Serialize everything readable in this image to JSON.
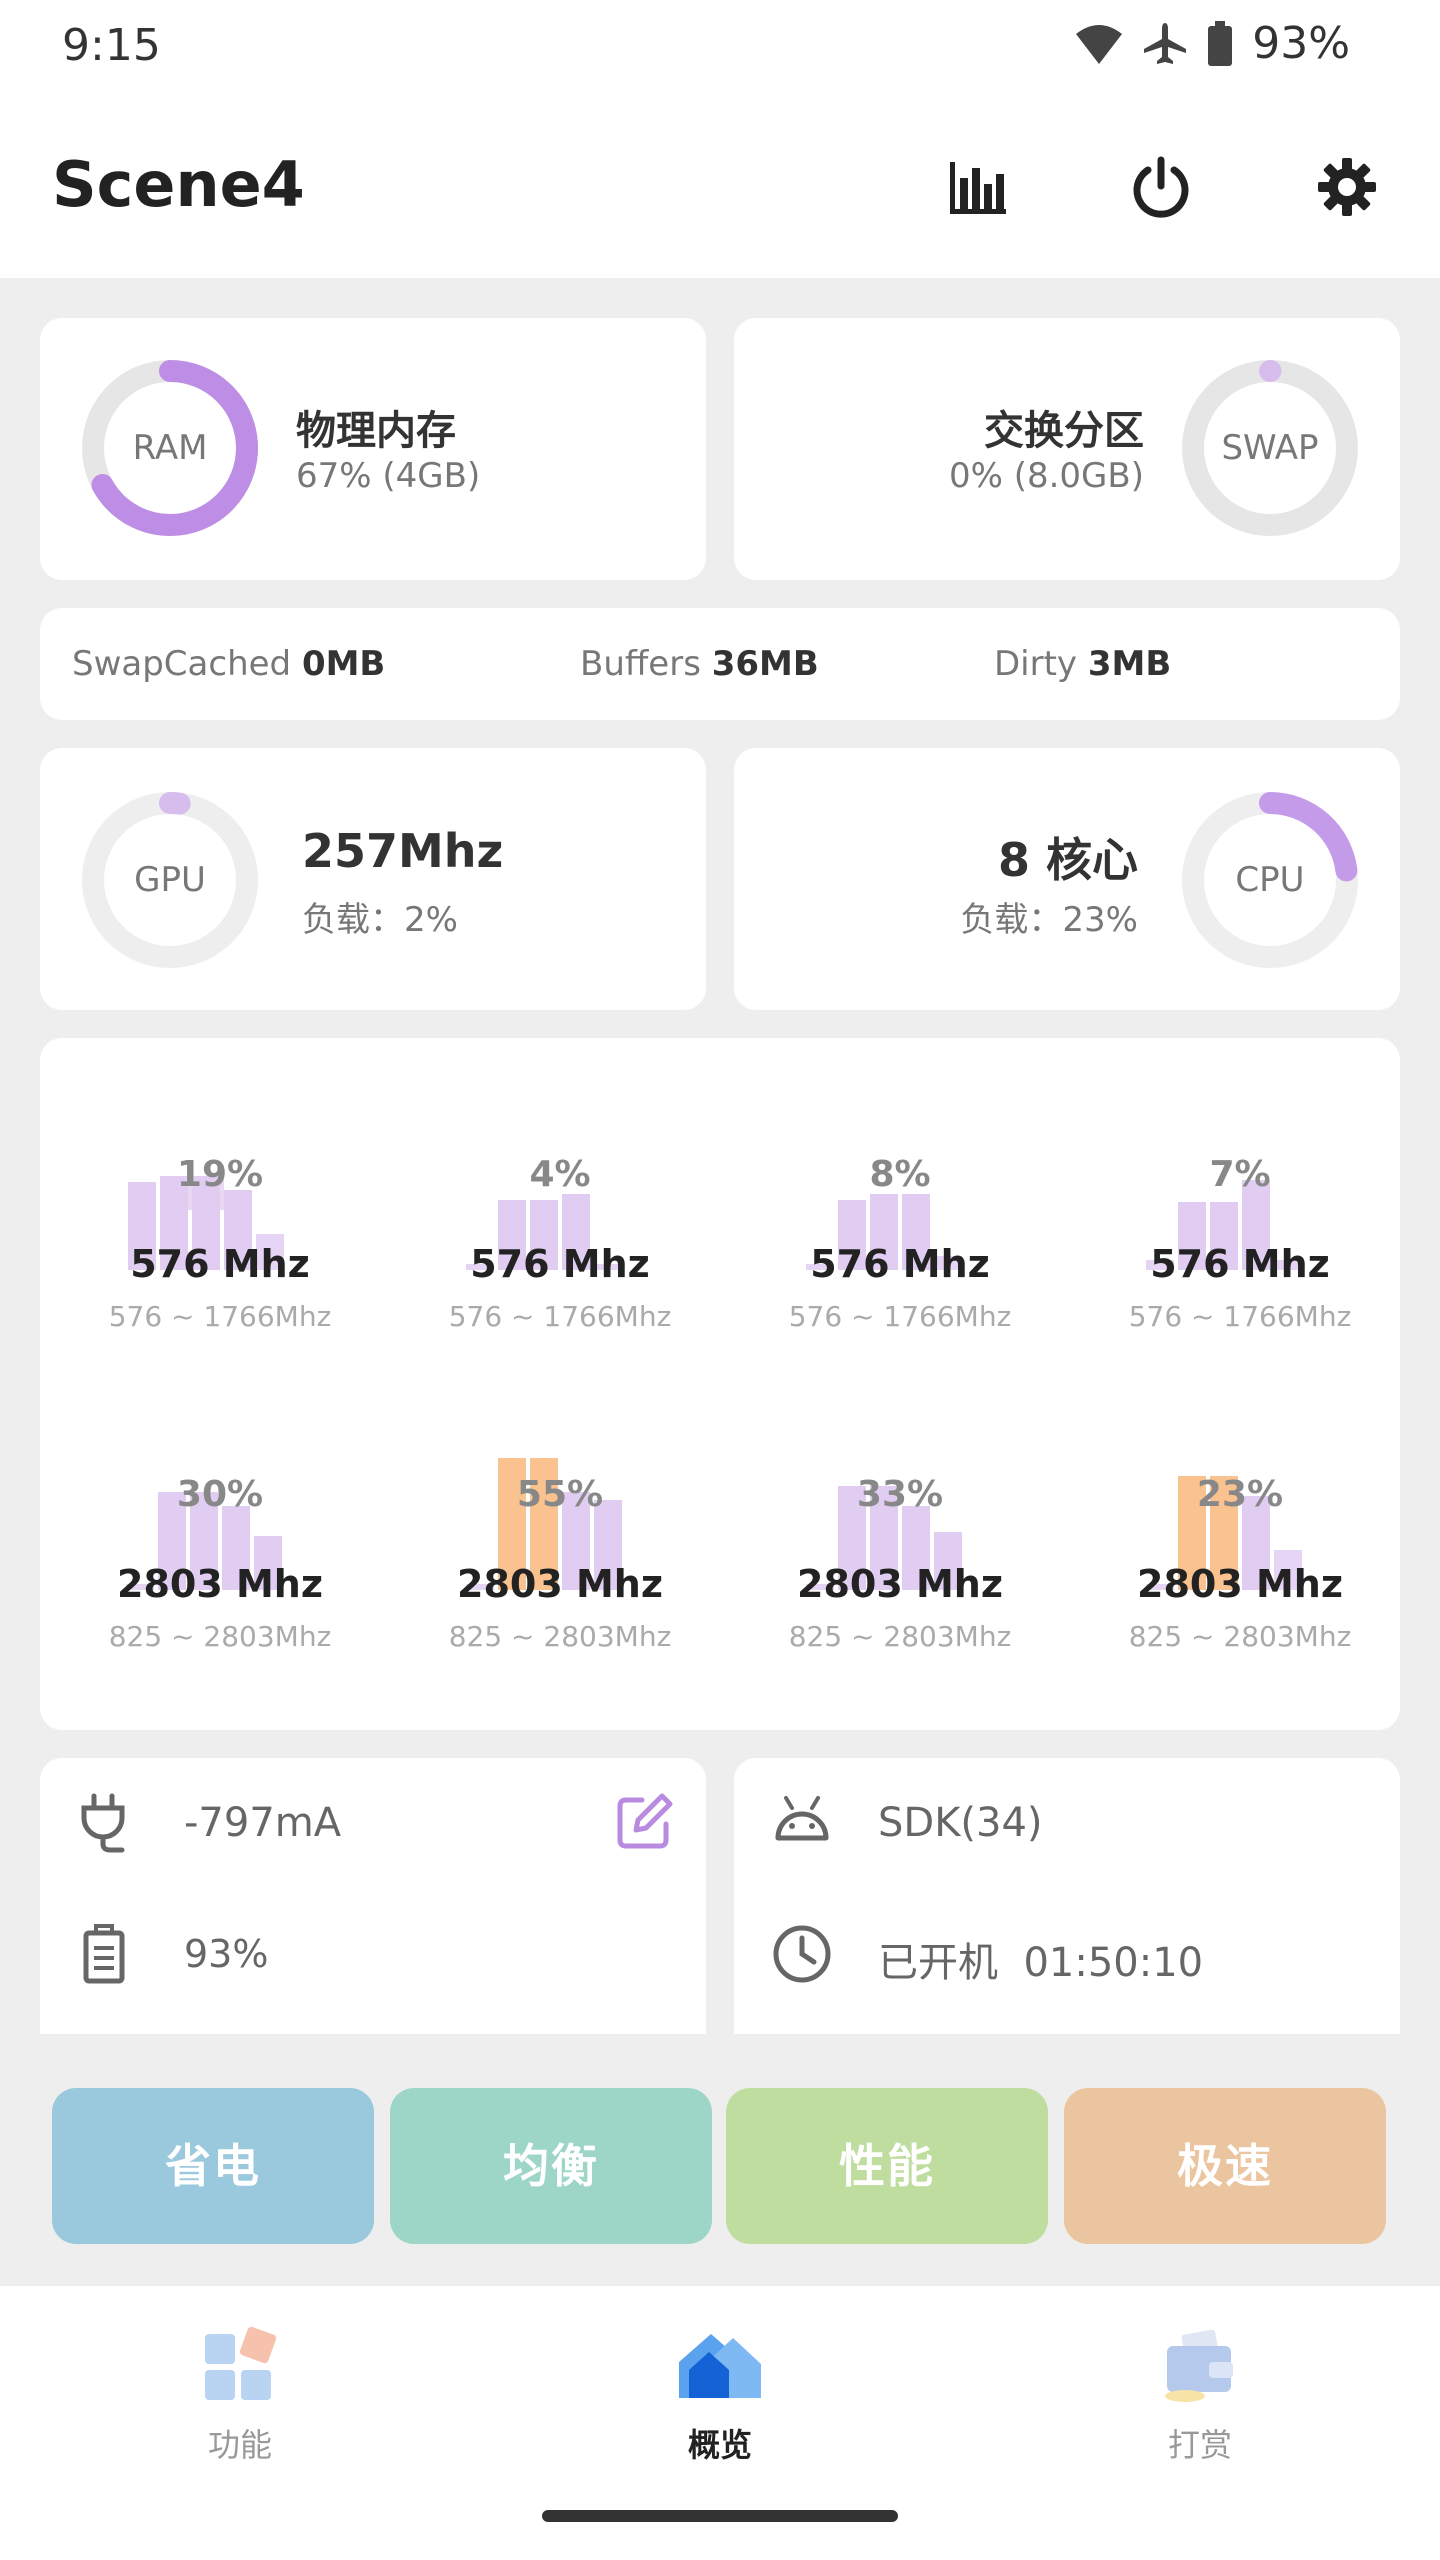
{
  "status_bar": {
    "time": "9:15",
    "battery_pct": "93%"
  },
  "app_bar": {
    "title": "Scene4"
  },
  "ram": {
    "ring_label": "RAM",
    "title": "物理内存",
    "detail": "67% (4GB)",
    "used_fraction": 0.67,
    "color": "#be8ee6"
  },
  "swap": {
    "ring_label": "SWAP",
    "title": "交换分区",
    "detail": "0% (8.0GB)",
    "used_fraction": 0.0,
    "color": "#d7bdee"
  },
  "mem_stats": [
    {
      "label": "SwapCached ",
      "value": "0MB"
    },
    {
      "label": "Buffers ",
      "value": "36MB"
    },
    {
      "label": "Dirty ",
      "value": "3MB"
    }
  ],
  "gpu": {
    "ring_label": "GPU",
    "freq": "257Mhz",
    "load": "负载：2%",
    "load_fraction": 0.02
  },
  "cpu": {
    "ring_label": "CPU",
    "cores": "8 核心",
    "load": "负载：23%",
    "load_fraction": 0.23
  },
  "cores": [
    {
      "pct": "19%",
      "freq": "576 Mhz",
      "range": "576 ~ 1766Mhz"
    },
    {
      "pct": "4%",
      "freq": "576 Mhz",
      "range": "576 ~ 1766Mhz"
    },
    {
      "pct": "8%",
      "freq": "576 Mhz",
      "range": "576 ~ 1766Mhz"
    },
    {
      "pct": "7%",
      "freq": "576 Mhz",
      "range": "576 ~ 1766Mhz"
    },
    {
      "pct": "30%",
      "freq": "2803 Mhz",
      "range": "825 ~ 2803Mhz"
    },
    {
      "pct": "55%",
      "freq": "2803 Mhz",
      "range": "825 ~ 2803Mhz"
    },
    {
      "pct": "33%",
      "freq": "2803 Mhz",
      "range": "825 ~ 2803Mhz"
    },
    {
      "pct": "23%",
      "freq": "2803 Mhz",
      "range": "825 ~ 2803Mhz"
    }
  ],
  "power": {
    "current": "-797mA",
    "battery": "93%"
  },
  "system": {
    "sdk": "SDK(34)",
    "uptime_label": "已开机",
    "uptime": "01:50:10"
  },
  "modes": [
    {
      "label": "省电",
      "color": "#9ac8dc"
    },
    {
      "label": "均衡",
      "color": "#9dd6c6"
    },
    {
      "label": "性能",
      "color": "#bedd9f"
    },
    {
      "label": "极速",
      "color": "#ebc59f"
    }
  ],
  "bottom_nav": [
    {
      "label": "功能",
      "icon": "grid-icon"
    },
    {
      "label": "概览",
      "icon": "home-icon"
    },
    {
      "label": "打赏",
      "icon": "wallet-icon"
    }
  ]
}
